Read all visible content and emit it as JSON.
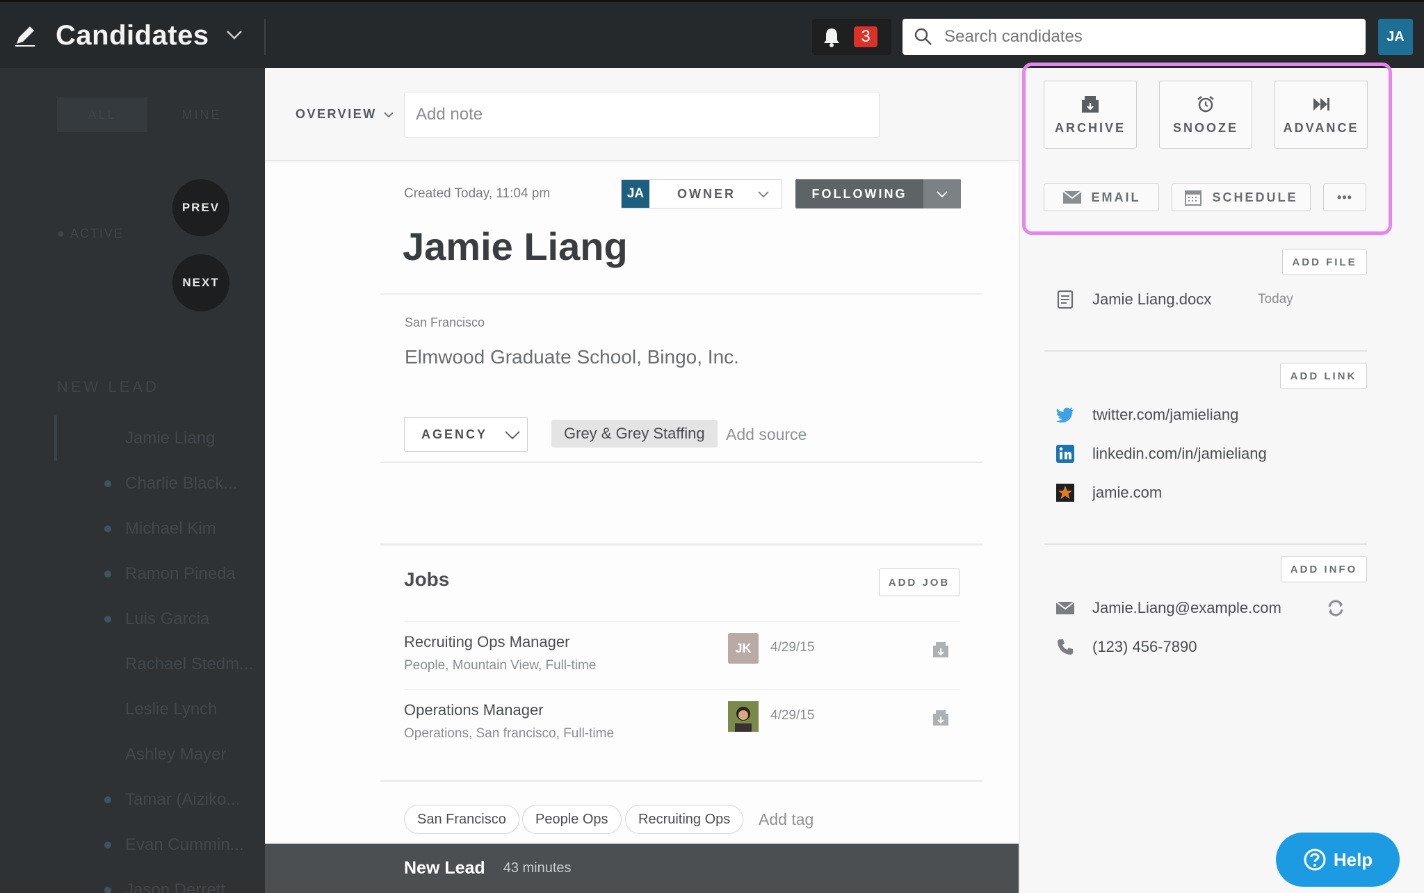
{
  "topbar": {
    "title": "Candidates",
    "notification_count": "3",
    "search_placeholder": "Search candidates",
    "user_initials": "JA"
  },
  "sidebar": {
    "tab_all": "ALL",
    "tab_mine": "MINE",
    "prev_label": "PREV",
    "next_label": "NEXT",
    "status": "ACTIVE",
    "section": "NEW LEAD",
    "items": [
      {
        "name": "Jamie Liang"
      },
      {
        "name": "Charlie Black..."
      },
      {
        "name": "Michael Kim"
      },
      {
        "name": "Ramon Pineda"
      },
      {
        "name": "Luis Garcia"
      },
      {
        "name": "Rachael Stedm..."
      },
      {
        "name": "Leslie Lynch"
      },
      {
        "name": "Ashley Mayer"
      },
      {
        "name": "Tamar (Aiziko..."
      },
      {
        "name": "Evan Cummin..."
      },
      {
        "name": "Jason Derrett..."
      }
    ]
  },
  "main": {
    "overview_label": "OVERVIEW",
    "note_placeholder": "Add note",
    "created": "Created Today, 11:04 pm",
    "owner_initials": "JA",
    "owner_label": "OWNER",
    "following_label": "FOLLOWING",
    "candidate_name": "Jamie Liang",
    "location": "San Francisco",
    "headline": "Elmwood Graduate School, Bingo, Inc.",
    "source_type": "AGENCY",
    "source_tag": "Grey & Grey Staffing",
    "add_source": "Add source",
    "jobs_title": "Jobs",
    "add_job": "ADD JOB",
    "jobs": [
      {
        "title": "Recruiting Ops Manager",
        "sub": "People, Mountain View, Full-time",
        "avatar": "JK",
        "date": "4/29/15"
      },
      {
        "title": "Operations Manager",
        "sub": "Operations, San francisco, Full-time",
        "avatar": "",
        "date": "4/29/15"
      }
    ],
    "tags": [
      "San Francisco",
      "People Ops",
      "Recruiting Ops"
    ],
    "add_tag": "Add tag",
    "footer_stage": "New Lead",
    "footer_time": "43 minutes"
  },
  "right": {
    "archive": "ARCHIVE",
    "snooze": "SNOOZE",
    "advance": "ADVANCE",
    "email": "EMAIL",
    "schedule": "SCHEDULE",
    "more": "•••",
    "add_file": "ADD FILE",
    "file_name": "Jamie Liang.docx",
    "file_date": "Today",
    "add_link": "ADD LINK",
    "links": [
      "twitter.com/jamieliang",
      "linkedin.com/in/jamieliang",
      "jamie.com"
    ],
    "add_info": "ADD INFO",
    "email_address": "Jamie.Liang@example.com",
    "phone": "(123) 456-7890"
  },
  "help_label": "Help",
  "colors": {
    "accent": "#1c9be3",
    "highlight": "#e486ec",
    "badge": "#d9322b",
    "topbar": "#26292c"
  }
}
